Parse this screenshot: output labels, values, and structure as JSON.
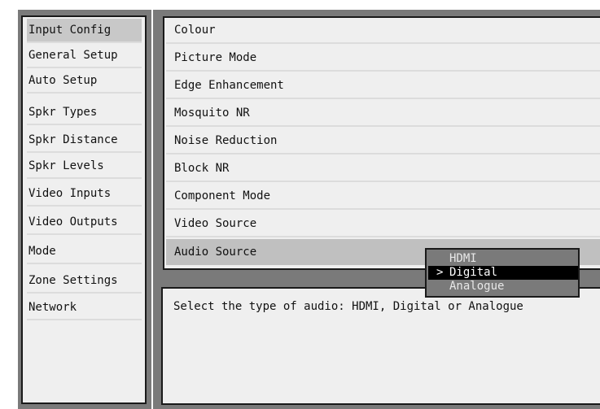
{
  "sidebar": {
    "items": [
      {
        "label": "Input Config",
        "active": true
      },
      {
        "label": "General Setup"
      },
      {
        "label": "Auto Setup"
      },
      {
        "label": "Spkr Types"
      },
      {
        "label": "Spkr Distance"
      },
      {
        "label": "Spkr Levels"
      },
      {
        "label": "Video Inputs"
      },
      {
        "label": "Video Outputs"
      },
      {
        "label": "Mode"
      },
      {
        "label": "Zone Settings"
      },
      {
        "label": "Network"
      }
    ]
  },
  "settings": {
    "items": [
      {
        "label": "Colour"
      },
      {
        "label": "Picture Mode"
      },
      {
        "label": "Edge Enhancement"
      },
      {
        "label": "Mosquito NR"
      },
      {
        "label": "Noise Reduction"
      },
      {
        "label": "Block NR"
      },
      {
        "label": "Component Mode"
      },
      {
        "label": "Video Source"
      },
      {
        "label": "Audio Source",
        "selected": true
      }
    ]
  },
  "dropdown": {
    "options": [
      "HDMI",
      "Digital",
      "Analogue"
    ],
    "selected": "Digital",
    "caret": ">"
  },
  "help": {
    "text": "Select the type of audio: HDMI, Digital or Analogue"
  },
  "colors": {
    "frame": "#7a7a7a",
    "panel_bg": "#efefef",
    "selected_row": "#c0c0c0",
    "dropdown_bg": "#7a7a7a",
    "dropdown_selected": "#000000"
  }
}
